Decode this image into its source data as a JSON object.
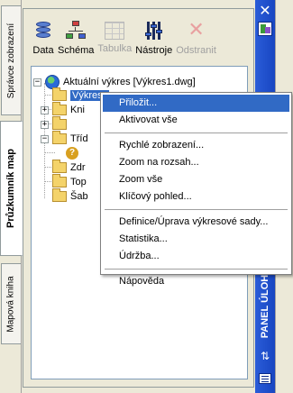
{
  "left_tabs": [
    {
      "label": "Správce zobrazení",
      "active": false
    },
    {
      "label": "Průzkumník map",
      "active": true
    },
    {
      "label": "Mapová kniha",
      "active": false
    }
  ],
  "toolbar": {
    "data_label": "Data",
    "schema_label": "Schéma",
    "table_label": "Tabulka",
    "tools_label": "Nástroje",
    "remove_label": "Odstranit"
  },
  "tree": {
    "root": "Aktuální výkres [Výkres1.dwg]",
    "items": [
      "Výkresy",
      "Kni",
      "Tříd",
      "",
      "Zdr",
      "Top",
      "Šab"
    ]
  },
  "context_menu": {
    "items": [
      "Přiložit...",
      "Aktivovat vše",
      "Rychlé zobrazení...",
      "Zoom na rozsah...",
      "Zoom vše",
      "Klíčový pohled...",
      "Definice/Úprava výkresové sady...",
      "Statistika...",
      "Údržba...",
      "Nápověda"
    ]
  },
  "titlebar": {
    "title": "PANEL ÚLOH",
    "close_glyph": "✕",
    "autohide_glyph": "⇅"
  },
  "colors": {
    "titlebar_blue": "#2a5cd8",
    "selection_blue": "#316ac5"
  }
}
